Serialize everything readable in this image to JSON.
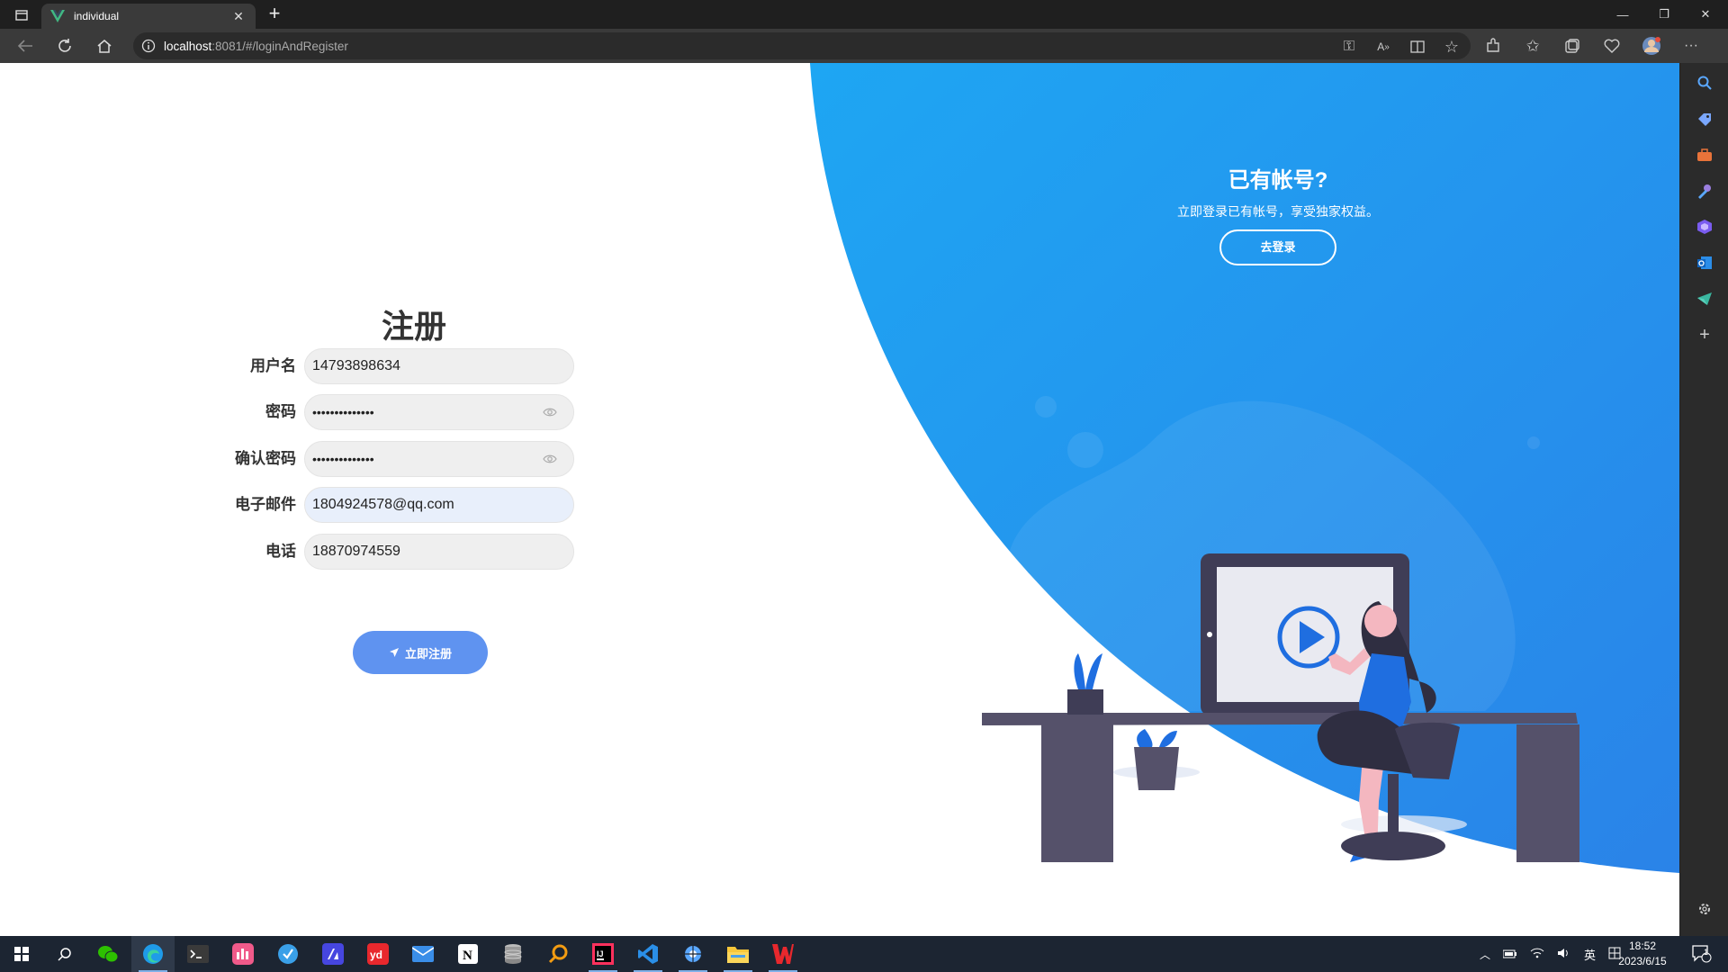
{
  "browser": {
    "tab_title": "individual",
    "url_host": "localhost",
    "url_rest": ":8081/#/loginAndRegister"
  },
  "register": {
    "title": "注册",
    "fields": [
      {
        "label": "用户名",
        "value": "14793898634",
        "type": "text"
      },
      {
        "label": "密码",
        "value": "••••••••••••••",
        "type": "password"
      },
      {
        "label": "确认密码",
        "value": "••••••••••••••",
        "type": "password"
      },
      {
        "label": "电子邮件",
        "value": "1804924578@qq.com",
        "type": "email"
      },
      {
        "label": "电话",
        "value": "18870974559",
        "type": "tel"
      }
    ],
    "submit_label": "立即注册"
  },
  "login_panel": {
    "heading": "已有帐号?",
    "description": "立即登录已有帐号，享受独家权益。",
    "button_label": "去登录"
  },
  "taskbar": {
    "time": "18:52",
    "date": "2023/6/15",
    "input_method": "英",
    "notification_count": "1"
  },
  "colors": {
    "accent_blue": "#1e96f0",
    "button_blue": "#5f93f0"
  }
}
